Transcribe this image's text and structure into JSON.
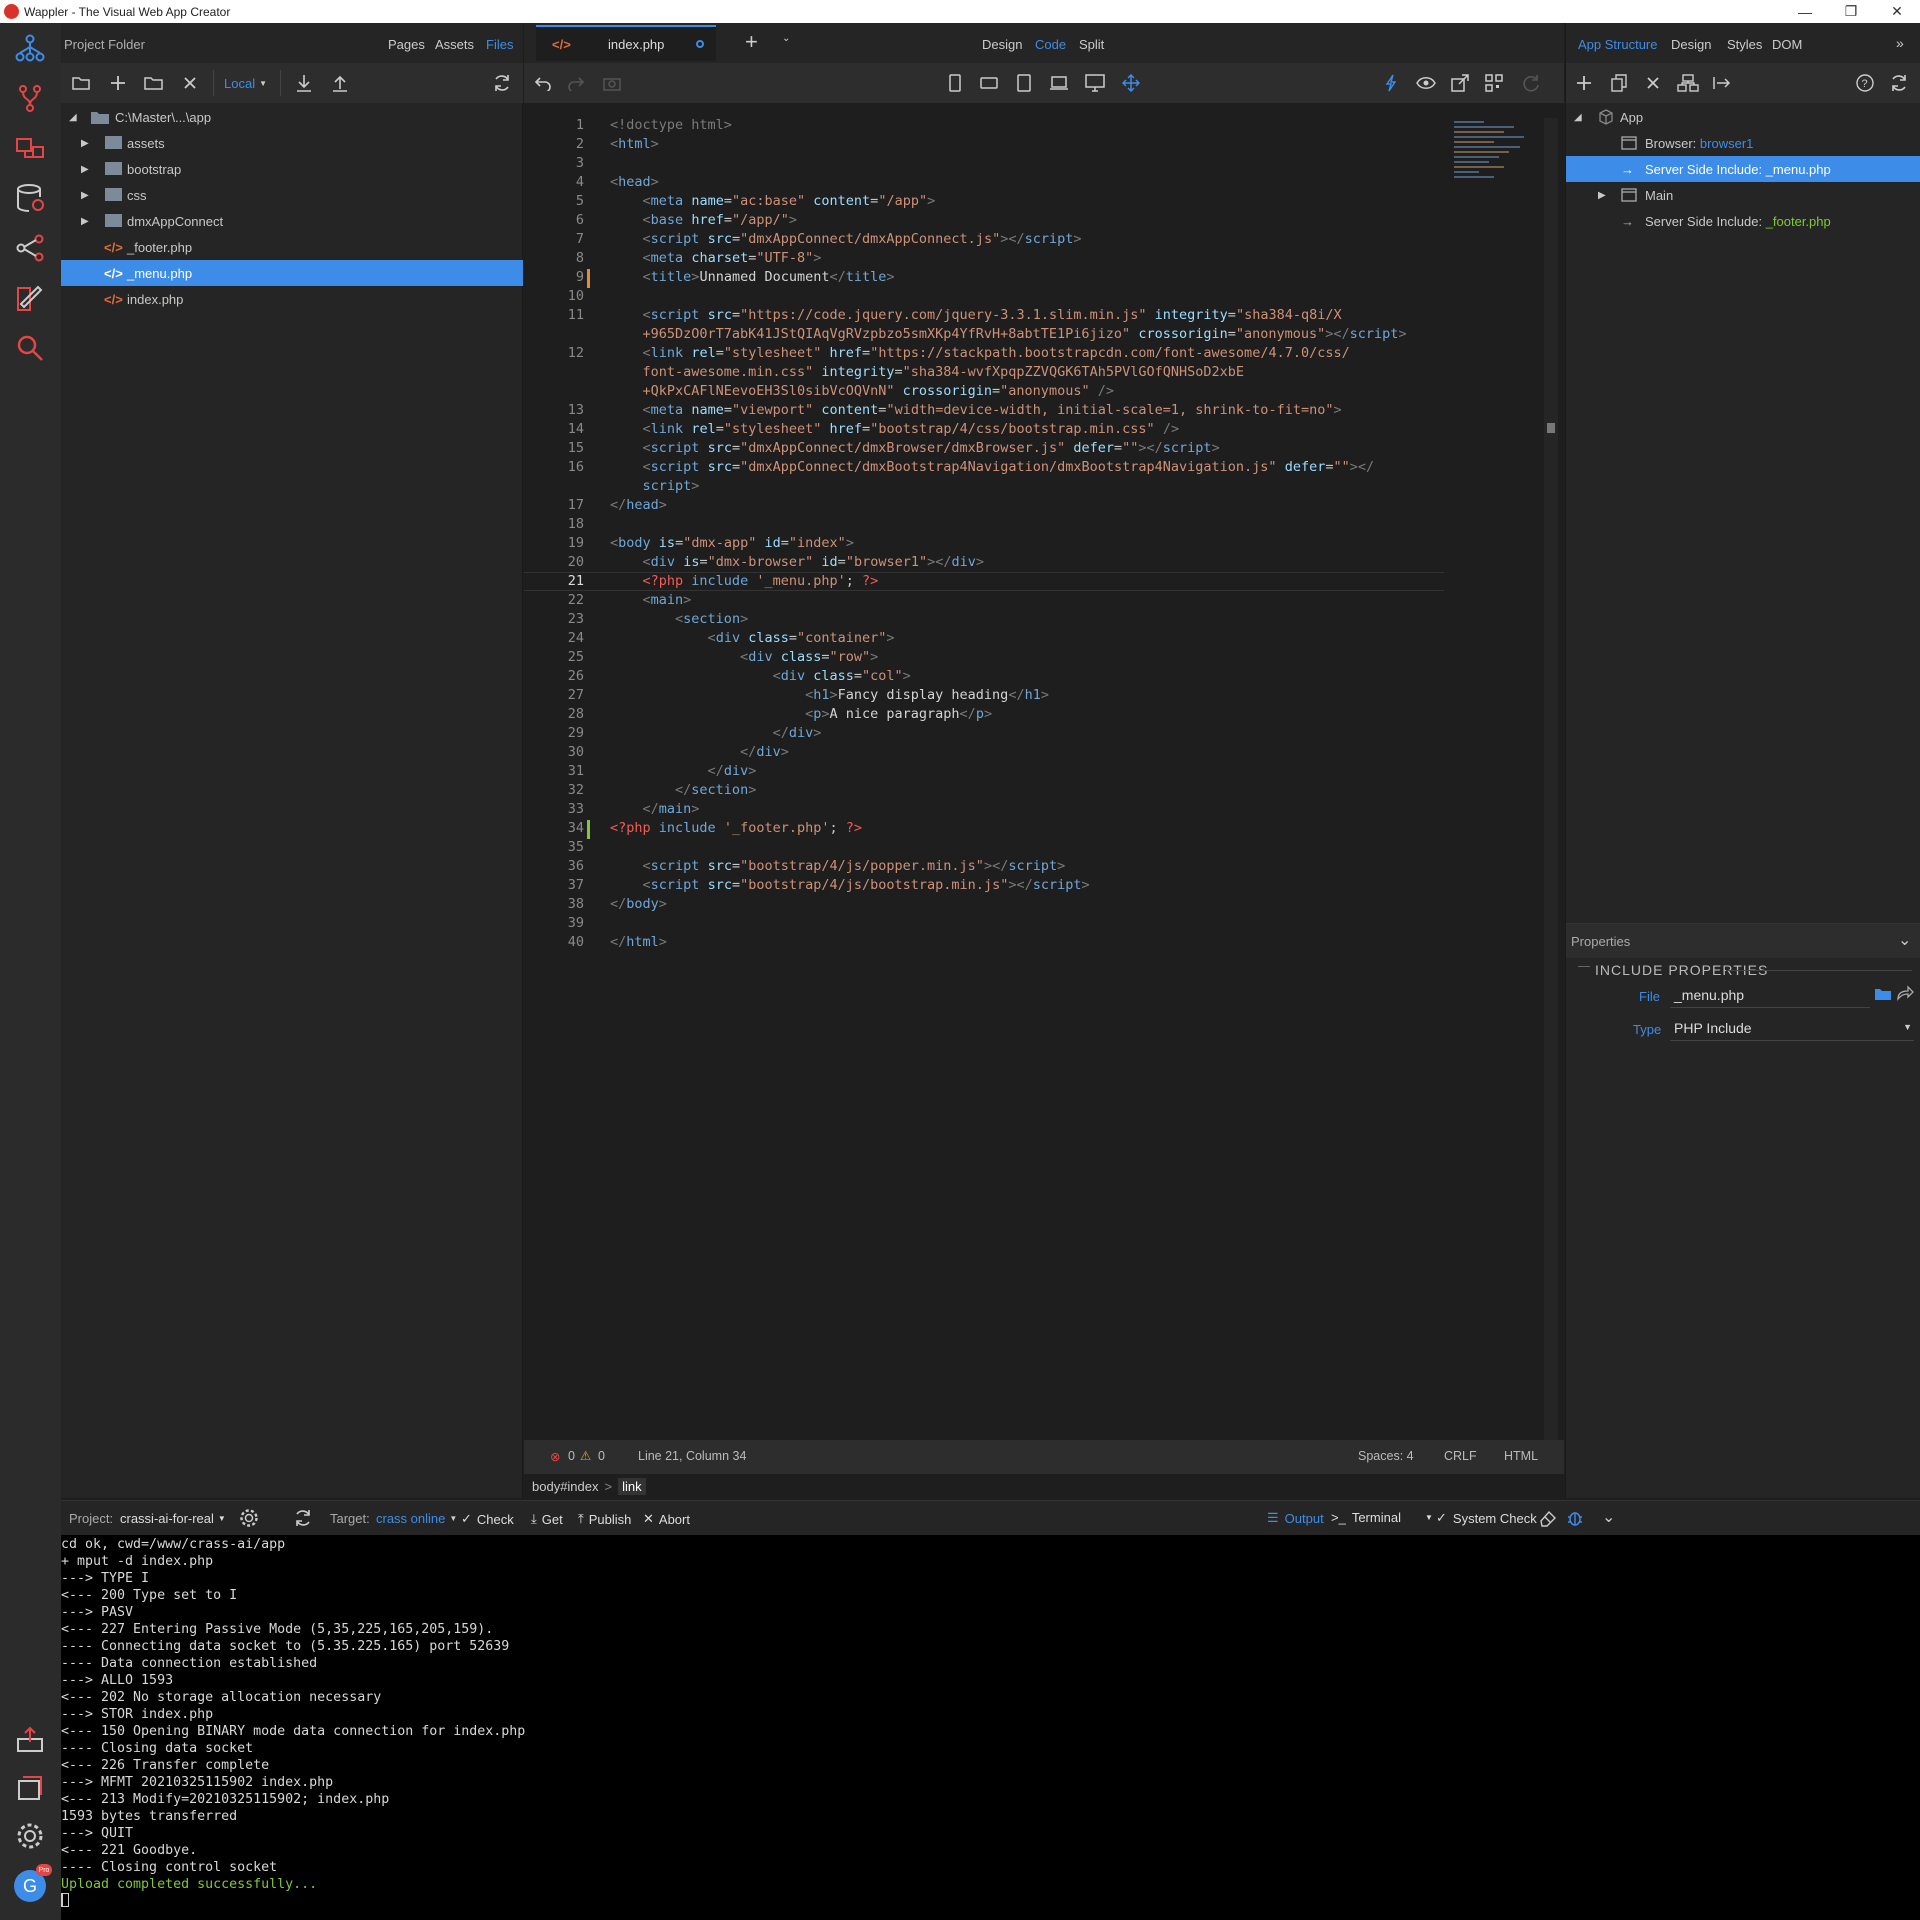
{
  "window": {
    "title": "Wappler - The Visual Web App Creator"
  },
  "left": {
    "header": "Project Folder",
    "tabs": [
      "Pages",
      "Assets",
      "Files"
    ],
    "target": "Local",
    "root": "C:\\Master\\...\\app",
    "items": [
      {
        "label": "assets",
        "type": "folder"
      },
      {
        "label": "bootstrap",
        "type": "folder"
      },
      {
        "label": "css",
        "type": "folder"
      },
      {
        "label": "dmxAppConnect",
        "type": "folder"
      },
      {
        "label": "_footer.php",
        "type": "php"
      },
      {
        "label": "_menu.php",
        "type": "php",
        "selected": true
      },
      {
        "label": "index.php",
        "type": "php"
      }
    ]
  },
  "editor": {
    "tab": "index.php",
    "modes": [
      "Design",
      "Code",
      "Split"
    ],
    "active_mode": "Code",
    "lines": [
      {
        "n": "1",
        "h": "<span class='br'>&lt;!doctype html&gt;</span>"
      },
      {
        "n": "2",
        "h": "<span class='br'>&lt;</span><span class='tag'>html</span><span class='br'>&gt;</span>"
      },
      {
        "n": "3",
        "h": ""
      },
      {
        "n": "4",
        "h": "<span class='br'>&lt;</span><span class='tag'>head</span><span class='br'>&gt;</span>"
      },
      {
        "n": "5",
        "h": "    <span class='br'>&lt;</span><span class='tag'>meta</span> <span class='attr'>name</span>=<span class='val'>\"ac:base\"</span> <span class='attr'>content</span>=<span class='val'>\"/app\"</span><span class='br'>&gt;</span>"
      },
      {
        "n": "6",
        "h": "    <span class='br'>&lt;</span><span class='tag'>base</span> <span class='attr'>href</span>=<span class='val'>\"/app/\"</span><span class='br'>&gt;</span>"
      },
      {
        "n": "7",
        "h": "    <span class='br'>&lt;</span><span class='tag'>script</span> <span class='attr'>src</span>=<span class='val'>\"dmxAppConnect/dmxAppConnect.js\"</span><span class='br'>&gt;&lt;/</span><span class='tag'>script</span><span class='br'>&gt;</span>"
      },
      {
        "n": "8",
        "h": "    <span class='br'>&lt;</span><span class='tag'>meta</span> <span class='attr'>charset</span>=<span class='val'>\"UTF-8\"</span><span class='br'>&gt;</span>"
      },
      {
        "n": "9",
        "h": "    <span class='br'>&lt;</span><span class='tag'>title</span><span class='br'>&gt;</span><span class='txt'>Unnamed Document</span><span class='br'>&lt;/</span><span class='tag'>title</span><span class='br'>&gt;</span>"
      },
      {
        "n": "10",
        "h": ""
      },
      {
        "n": "11",
        "h": "    <span class='br'>&lt;</span><span class='tag'>script</span> <span class='attr'>src</span>=<span class='val'>\"https://code.jquery.com/jquery-3.3.1.slim.min.js\"</span> <span class='attr'>integrity</span>=<span class='val'>\"sha384-q8i/X</span>"
      },
      {
        "n": "",
        "h": "    <span class='val'>+965DzO0rT7abK41JStQIAqVgRVzpbzo5smXKp4YfRvH+8abtTE1Pi6jizo\"</span> <span class='attr'>crossorigin</span>=<span class='val'>\"anonymous\"</span><span class='br'>&gt;&lt;/</span><span class='tag'>script</span><span class='br'>&gt;</span>"
      },
      {
        "n": "12",
        "h": "    <span class='br'>&lt;</span><span class='tag'>link</span> <span class='attr'>rel</span>=<span class='val'>\"stylesheet\"</span> <span class='attr'>href</span>=<span class='val'>\"https://stackpath.bootstrapcdn.com/font-awesome/4.7.0/css/</span>"
      },
      {
        "n": "",
        "h": "    <span class='val'>font-awesome.min.css\"</span> <span class='attr'>integrity</span>=<span class='val'>\"sha384-wvfXpqpZZVQGK6TAh5PVlGOfQNHSoD2xbE</span>"
      },
      {
        "n": "",
        "h": "    <span class='val'>+QkPxCAFlNEevoEH3Sl0sibVcOQVnN\"</span> <span class='attr'>crossorigin</span>=<span class='val'>\"anonymous\"</span> <span class='br'>/&gt;</span>"
      },
      {
        "n": "13",
        "h": "    <span class='br'>&lt;</span><span class='tag'>meta</span> <span class='attr'>name</span>=<span class='val'>\"viewport\"</span> <span class='attr'>content</span>=<span class='val'>\"width=device-width, initial-scale=1, shrink-to-fit=no\"</span><span class='br'>&gt;</span>"
      },
      {
        "n": "14",
        "h": "    <span class='br'>&lt;</span><span class='tag'>link</span> <span class='attr'>rel</span>=<span class='val'>\"stylesheet\"</span> <span class='attr'>href</span>=<span class='val'>\"bootstrap/4/css/bootstrap.min.css\"</span> <span class='br'>/&gt;</span>"
      },
      {
        "n": "15",
        "h": "    <span class='br'>&lt;</span><span class='tag'>script</span> <span class='attr'>src</span>=<span class='val'>\"dmxAppConnect/dmxBrowser/dmxBrowser.js\"</span> <span class='attr'>defer</span>=<span class='val'>\"\"</span><span class='br'>&gt;&lt;/</span><span class='tag'>script</span><span class='br'>&gt;</span>"
      },
      {
        "n": "16",
        "h": "    <span class='br'>&lt;</span><span class='tag'>script</span> <span class='attr'>src</span>=<span class='val'>\"dmxAppConnect/dmxBootstrap4Navigation/dmxBootstrap4Navigation.js\"</span> <span class='attr'>defer</span>=<span class='val'>\"\"</span><span class='br'>&gt;&lt;/</span>"
      },
      {
        "n": "",
        "h": "    <span class='tag'>script</span><span class='br'>&gt;</span>"
      },
      {
        "n": "17",
        "h": "<span class='br'>&lt;/</span><span class='tag'>head</span><span class='br'>&gt;</span>"
      },
      {
        "n": "18",
        "h": ""
      },
      {
        "n": "19",
        "h": "<span class='br'>&lt;</span><span class='tag'>body</span> <span class='attr'>is</span>=<span class='val'>\"dmx-app\"</span> <span class='attr'>id</span>=<span class='val'>\"index\"</span><span class='br'>&gt;</span>"
      },
      {
        "n": "20",
        "h": "    <span class='br'>&lt;</span><span class='tag'>div</span> <span class='attr'>is</span>=<span class='val'>\"dmx-browser\"</span> <span class='attr'>id</span>=<span class='val'>\"browser1\"</span><span class='br'>&gt;&lt;/</span><span class='tag'>div</span><span class='br'>&gt;</span>"
      },
      {
        "n": "21",
        "h": "    <span class='php'>&lt;?php</span> <span class='tag'>include</span> <span class='val'>'_menu.php'</span>; <span class='php'>?&gt;</span>"
      },
      {
        "n": "22",
        "h": "    <span class='br'>&lt;</span><span class='tag'>main</span><span class='br'>&gt;</span>"
      },
      {
        "n": "23",
        "h": "        <span class='br'>&lt;</span><span class='tag'>section</span><span class='br'>&gt;</span>"
      },
      {
        "n": "24",
        "h": "            <span class='br'>&lt;</span><span class='tag'>div</span> <span class='attr'>class</span>=<span class='val'>\"container\"</span><span class='br'>&gt;</span>"
      },
      {
        "n": "25",
        "h": "                <span class='br'>&lt;</span><span class='tag'>div</span> <span class='attr'>class</span>=<span class='val'>\"row\"</span><span class='br'>&gt;</span>"
      },
      {
        "n": "26",
        "h": "                    <span class='br'>&lt;</span><span class='tag'>div</span> <span class='attr'>class</span>=<span class='val'>\"col\"</span><span class='br'>&gt;</span>"
      },
      {
        "n": "27",
        "h": "                        <span class='br'>&lt;</span><span class='tag'>h1</span><span class='br'>&gt;</span><span class='txt'>Fancy display heading</span><span class='br'>&lt;/</span><span class='tag'>h1</span><span class='br'>&gt;</span>"
      },
      {
        "n": "28",
        "h": "                        <span class='br'>&lt;</span><span class='tag'>p</span><span class='br'>&gt;</span><span class='txt'>A nice paragraph</span><span class='br'>&lt;/</span><span class='tag'>p</span><span class='br'>&gt;</span>"
      },
      {
        "n": "29",
        "h": "                    <span class='br'>&lt;/</span><span class='tag'>div</span><span class='br'>&gt;</span>"
      },
      {
        "n": "30",
        "h": "                <span class='br'>&lt;/</span><span class='tag'>div</span><span class='br'>&gt;</span>"
      },
      {
        "n": "31",
        "h": "            <span class='br'>&lt;/</span><span class='tag'>div</span><span class='br'>&gt;</span>"
      },
      {
        "n": "32",
        "h": "        <span class='br'>&lt;/</span><span class='tag'>section</span><span class='br'>&gt;</span>"
      },
      {
        "n": "33",
        "h": "    <span class='br'>&lt;/</span><span class='tag'>main</span><span class='br'>&gt;</span>"
      },
      {
        "n": "34",
        "h": "<span class='php'>&lt;?php</span> <span class='tag'>include</span> <span class='val'>'_footer.php'</span>; <span class='php'>?&gt;</span>"
      },
      {
        "n": "35",
        "h": ""
      },
      {
        "n": "36",
        "h": "    <span class='br'>&lt;</span><span class='tag'>script</span> <span class='attr'>src</span>=<span class='val'>\"bootstrap/4/js/popper.min.js\"</span><span class='br'>&gt;&lt;/</span><span class='tag'>script</span><span class='br'>&gt;</span>"
      },
      {
        "n": "37",
        "h": "    <span class='br'>&lt;</span><span class='tag'>script</span> <span class='attr'>src</span>=<span class='val'>\"bootstrap/4/js/bootstrap.min.js\"</span><span class='br'>&gt;&lt;/</span><span class='tag'>script</span><span class='br'>&gt;</span>"
      },
      {
        "n": "38",
        "h": "<span class='br'>&lt;/</span><span class='tag'>body</span><span class='br'>&gt;</span>"
      },
      {
        "n": "39",
        "h": ""
      },
      {
        "n": "40",
        "h": "<span class='br'>&lt;/</span><span class='tag'>html</span><span class='br'>&gt;</span>"
      }
    ],
    "status": {
      "errors": "0",
      "warnings": "0",
      "position": "Line 21, Column 34",
      "spaces": "Spaces: 4",
      "eol": "CRLF",
      "lang": "HTML"
    },
    "breadcrumb": [
      "body#index",
      "link"
    ]
  },
  "right": {
    "tabs": [
      "App Structure",
      "Design",
      "Styles",
      "DOM"
    ],
    "tree": [
      {
        "label": "App",
        "value": ""
      },
      {
        "label": "Browser: ",
        "value": "browser1"
      },
      {
        "label": "Server Side Include: ",
        "value": "_menu.php",
        "selected": true
      },
      {
        "label": "Main",
        "value": ""
      },
      {
        "label": "Server Side Include: ",
        "value": "_footer.php"
      }
    ],
    "properties": {
      "header": "Properties",
      "section": "INCLUDE PROPERTIES",
      "file_label": "File",
      "file_value": "_menu.php",
      "type_label": "Type",
      "type_value": "PHP Include"
    }
  },
  "bottom": {
    "project_label": "Project:",
    "project_value": "crassi-ai-for-real",
    "target_label": "Target:",
    "target_value": "crass online",
    "actions": [
      "Check",
      "Get",
      "Publish",
      "Abort"
    ],
    "tabs": [
      "Output",
      "Terminal",
      "System Check"
    ],
    "console": [
      "cd ok, cwd=/www/crass-ai/app",
      "+ mput -d index.php",
      "---> TYPE I",
      "<--- 200 Type set to I",
      "---> PASV",
      "<--- 227 Entering Passive Mode (5,35,225,165,205,159).",
      "---- Connecting data socket to (5.35.225.165) port 52639",
      "---- Data connection established",
      "---> ALLO 1593",
      "<--- 202 No storage allocation necessary",
      "---> STOR index.php",
      "<--- 150 Opening BINARY mode data connection for index.php",
      "---- Closing data socket",
      "<--- 226 Transfer complete",
      "---> MFMT 20210325115902 index.php",
      "<--- 213 Modify=20210325115902; index.php",
      "1593 bytes transferred",
      "---> QUIT",
      "<--- 221 Goodbye.",
      "---- Closing control socket"
    ],
    "success": "Upload completed successfully..."
  },
  "colors": {
    "accent": "#3d8ce8",
    "success": "#7ec83a",
    "php": "#f25c54"
  }
}
